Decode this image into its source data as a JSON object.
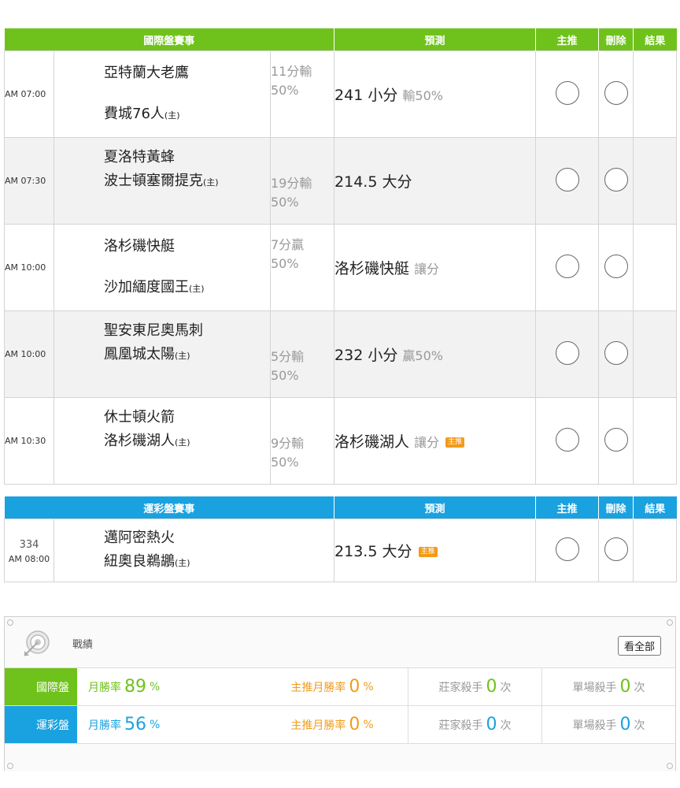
{
  "intl": {
    "header": {
      "event": "國際盤賽事",
      "predict": "預測",
      "recommend": "主推",
      "delete": "刪除",
      "result": "結果"
    },
    "games": [
      {
        "time": "AM 07:00",
        "team1": "亞特蘭大老鷹",
        "team2": "費城76人",
        "host": "(主)",
        "odds1": "11分輸",
        "odds2": "50%",
        "pred_main": "241 小分",
        "pred_note": "輸50%",
        "badge": ""
      },
      {
        "time": "AM 07:30",
        "team1": "夏洛特黃蜂",
        "team2": "波士頓塞爾提克",
        "host": "(主)",
        "odds1": "19分輸",
        "odds2": "50%",
        "pred_main": "214.5 大分",
        "pred_note": "",
        "badge": ""
      },
      {
        "time": "AM 10:00",
        "team1": "洛杉磯快艇",
        "team2": "沙加緬度國王",
        "host": "(主)",
        "odds1": "7分贏",
        "odds2": "50%",
        "pred_main": "洛杉磯快艇",
        "pred_note": "讓分",
        "badge": ""
      },
      {
        "time": "AM 10:00",
        "team1": "聖安東尼奧馬刺",
        "team2": "鳳凰城太陽",
        "host": "(主)",
        "odds1": "5分輸",
        "odds2": "50%",
        "pred_main": "232 小分",
        "pred_note": "贏50%",
        "badge": ""
      },
      {
        "time": "AM 10:30",
        "team1": "休士頓火箭",
        "team2": "洛杉磯湖人",
        "host": "(主)",
        "odds1": "9分輸",
        "odds2": "50%",
        "pred_main": "洛杉磯湖人",
        "pred_note": "讓分",
        "badge": "主推"
      }
    ]
  },
  "lottery": {
    "header": {
      "event": "運彩盤賽事",
      "predict": "預測",
      "recommend": "主推",
      "delete": "刪除",
      "result": "結果"
    },
    "games": [
      {
        "num": "334",
        "time": "AM 08:00",
        "team1": "邁阿密熱火",
        "team2": "紐奧良鵜鶘",
        "host": "(主)",
        "pred_main": "213.5 大分",
        "badge": "主推"
      }
    ]
  },
  "stats": {
    "title": "戰績",
    "view_all": "看全部",
    "rows": [
      {
        "label": "國際盤",
        "win_label": "月勝率",
        "win_value": "89",
        "pct": "%",
        "rec_label": "主推月勝率",
        "rec_value": "0",
        "banker_label": "莊家殺手",
        "banker_value": "0",
        "single_label": "單場殺手",
        "single_value": "0",
        "times": "次"
      },
      {
        "label": "運彩盤",
        "win_label": "月勝率",
        "win_value": "56",
        "pct": "%",
        "rec_label": "主推月勝率",
        "rec_value": "0",
        "banker_label": "莊家殺手",
        "banker_value": "0",
        "single_label": "單場殺手",
        "single_value": "0",
        "times": "次"
      }
    ]
  },
  "colors": {
    "intl": "#6fc21b",
    "lottery": "#1aa2e0",
    "badge": "#f29b1a"
  }
}
